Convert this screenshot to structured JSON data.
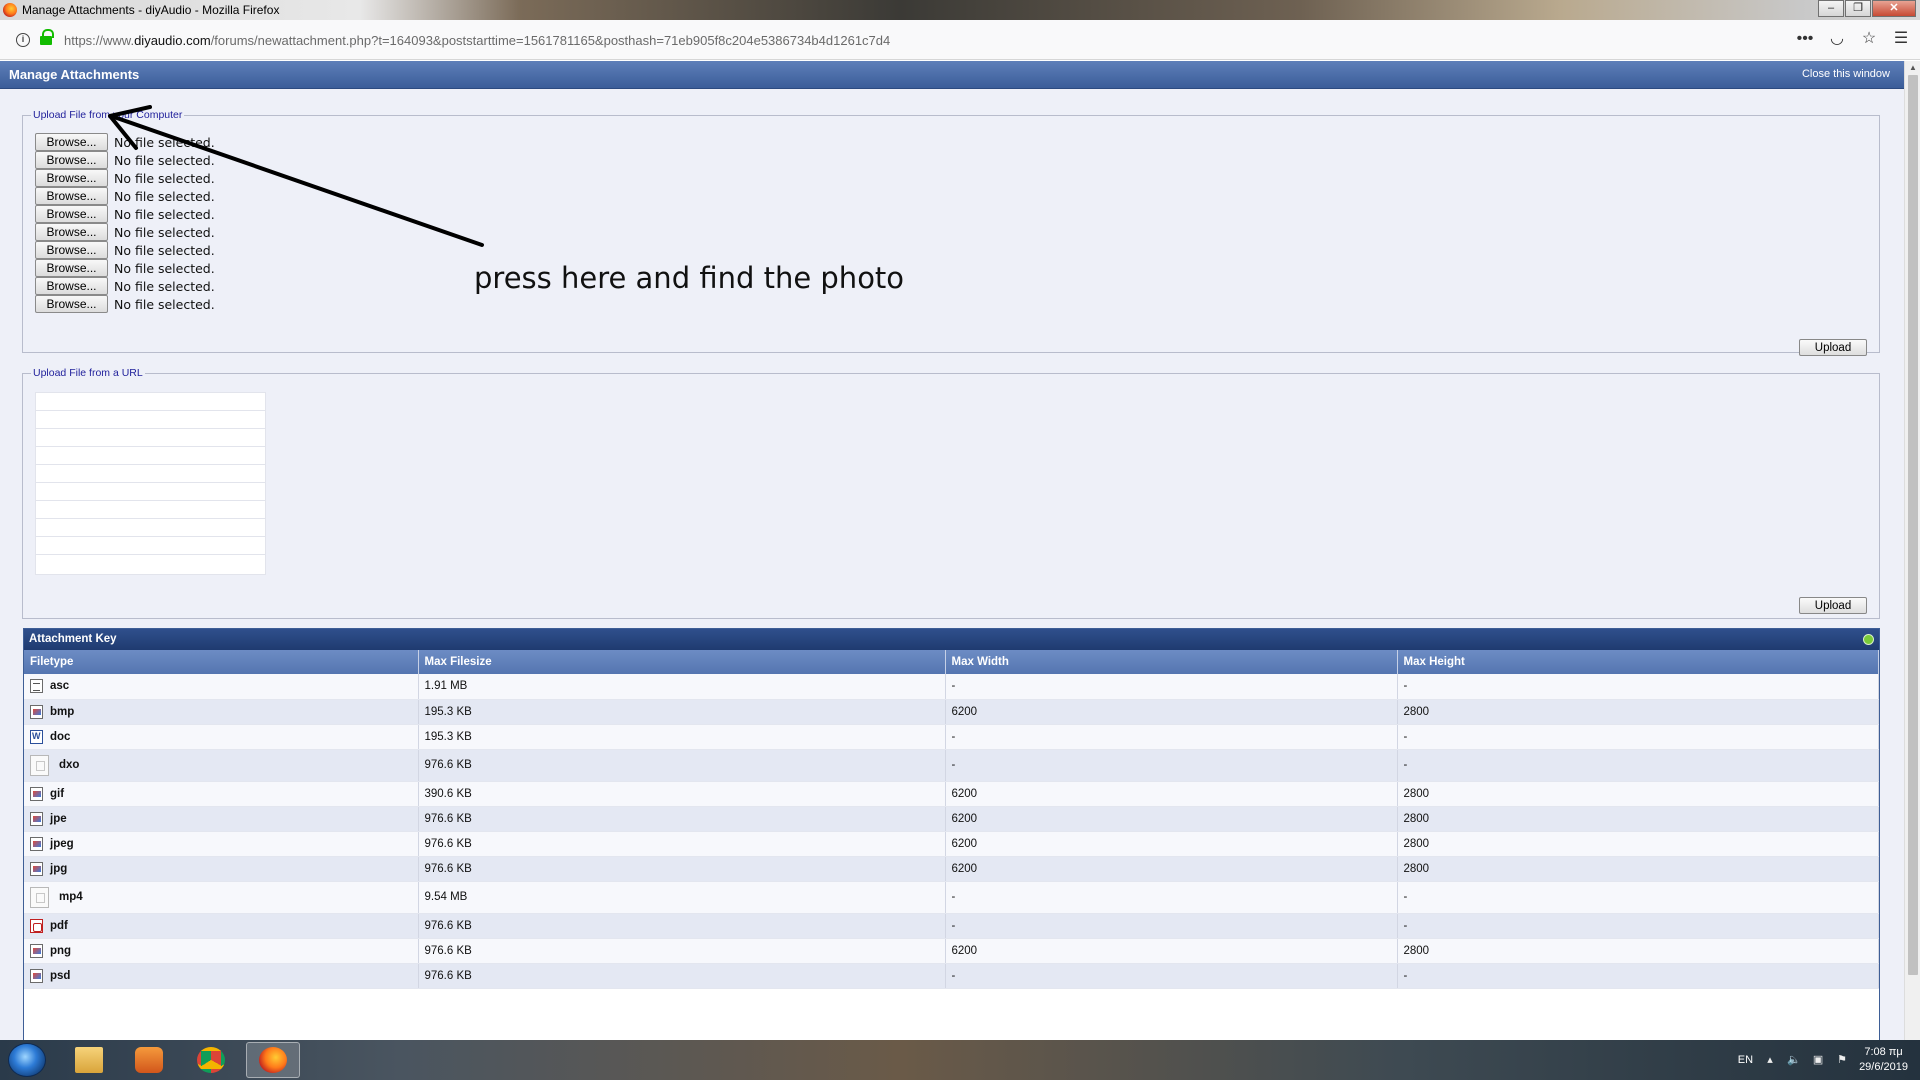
{
  "window": {
    "title": "Manage Attachments - diyAudio - Mozilla Firefox"
  },
  "browser": {
    "url_prefix": "https://www.",
    "url_domain": "diyaudio.com",
    "url_path": "/forums/newattachment.php?t=164093&poststarttime=1561781165&posthash=71eb905f8c204e5386734b4d1261c7d4"
  },
  "page": {
    "title": "Manage Attachments",
    "close_label": "Close this window"
  },
  "upload_computer": {
    "legend": "Upload File from your Computer",
    "browse_label": "Browse...",
    "no_file_text": "No file selected.",
    "upload_label": "Upload"
  },
  "upload_url": {
    "legend": "Upload File from a URL",
    "upload_label": "Upload"
  },
  "annotation": {
    "text": "press here and find the photo"
  },
  "attachment_key": {
    "title": "Attachment Key",
    "columns": [
      "Filetype",
      "Max Filesize",
      "Max Width",
      "Max Height"
    ],
    "rows": [
      {
        "type": "asc",
        "icon": "text-file-icon",
        "size": "1.91 MB",
        "width": "-",
        "height": "-"
      },
      {
        "type": "bmp",
        "icon": "image-file-icon",
        "size": "195.3 KB",
        "width": "6200",
        "height": "2800"
      },
      {
        "type": "doc",
        "icon": "word-file-icon",
        "size": "195.3 KB",
        "width": "-",
        "height": "-"
      },
      {
        "type": "dxo",
        "icon": "generic-file-icon",
        "size": "976.6 KB",
        "width": "-",
        "height": "-"
      },
      {
        "type": "gif",
        "icon": "image-file-icon",
        "size": "390.6 KB",
        "width": "6200",
        "height": "2800"
      },
      {
        "type": "jpe",
        "icon": "image-file-icon",
        "size": "976.6 KB",
        "width": "6200",
        "height": "2800"
      },
      {
        "type": "jpeg",
        "icon": "image-file-icon",
        "size": "976.6 KB",
        "width": "6200",
        "height": "2800"
      },
      {
        "type": "jpg",
        "icon": "image-file-icon",
        "size": "976.6 KB",
        "width": "6200",
        "height": "2800"
      },
      {
        "type": "mp4",
        "icon": "generic-file-icon",
        "size": "9.54 MB",
        "width": "-",
        "height": "-"
      },
      {
        "type": "pdf",
        "icon": "pdf-file-icon",
        "size": "976.6 KB",
        "width": "-",
        "height": "-"
      },
      {
        "type": "png",
        "icon": "image-file-icon",
        "size": "976.6 KB",
        "width": "6200",
        "height": "2800"
      },
      {
        "type": "psd",
        "icon": "image-file-icon",
        "size": "976.6 KB",
        "width": "-",
        "height": "-"
      }
    ]
  },
  "taskbar": {
    "language": "EN",
    "time": "7:08 πμ",
    "date": "29/6/2019"
  },
  "colors": {
    "header_blue": "#3b5d99",
    "key_header": "#1f3b70",
    "legend_text": "#22229c",
    "page_bg": "#eef0f8"
  }
}
